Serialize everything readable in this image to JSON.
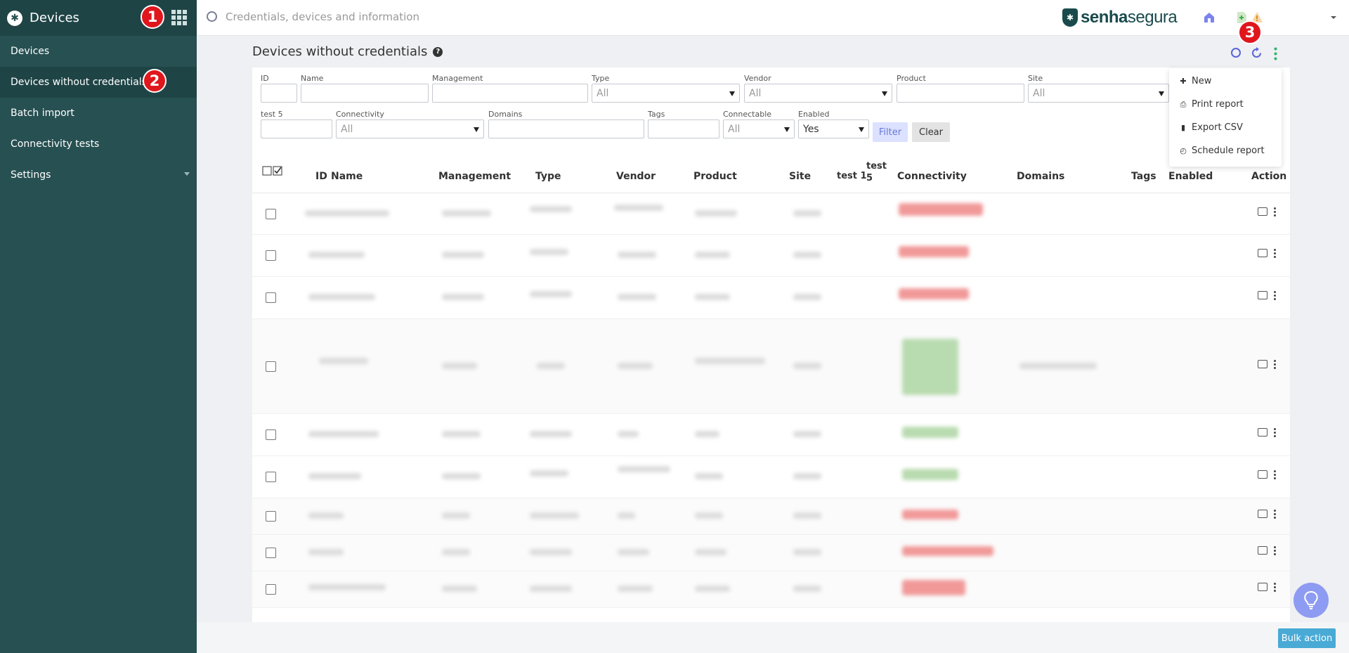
{
  "sidebar": {
    "title": "Devices",
    "items": [
      {
        "label": "Devices"
      },
      {
        "label": "Devices without credentials"
      },
      {
        "label": "Batch import"
      },
      {
        "label": "Connectivity tests"
      },
      {
        "label": "Settings"
      }
    ]
  },
  "markers": [
    "1",
    "2",
    "3"
  ],
  "topbar": {
    "search_placeholder": "Credentials, devices and information",
    "brand_bold": "senha",
    "brand_light": "segura"
  },
  "page": {
    "title": "Devices without credentials"
  },
  "filters": {
    "id": {
      "label": "ID",
      "value": ""
    },
    "name": {
      "label": "Name",
      "value": ""
    },
    "management": {
      "label": "Management",
      "value": ""
    },
    "type": {
      "label": "Type",
      "value": "All"
    },
    "vendor": {
      "label": "Vendor",
      "value": "All"
    },
    "product": {
      "label": "Product",
      "value": ""
    },
    "site": {
      "label": "Site",
      "value": "All"
    },
    "test5": {
      "label": "test 5",
      "value": ""
    },
    "connectivity": {
      "label": "Connectivity",
      "value": "All"
    },
    "domains": {
      "label": "Domains",
      "value": ""
    },
    "tags": {
      "label": "Tags",
      "value": ""
    },
    "connectable": {
      "label": "Connectable",
      "value": "All"
    },
    "enabled": {
      "label": "Enabled",
      "value": "Yes"
    },
    "filter_button": "Filter",
    "clear_button": "Clear"
  },
  "table": {
    "columns": [
      "ID",
      "Name",
      "Management",
      "Type",
      "Vendor",
      "Product",
      "Site",
      "test 1",
      "test 5",
      "Connectivity",
      "Domains",
      "Tags",
      "Enabled",
      "Action"
    ]
  },
  "dropdown": {
    "items": [
      {
        "icon": "plus-icon",
        "label": "New"
      },
      {
        "icon": "print-icon",
        "label": "Print report"
      },
      {
        "icon": "file-icon",
        "label": "Export CSV"
      },
      {
        "icon": "clock-icon",
        "label": "Schedule report"
      }
    ]
  },
  "bottom": {
    "bulk_action": "Bulk action"
  },
  "colors": {
    "sidebar_bg": "#275052",
    "sidebar_active": "#1f4446",
    "accent_blue": "#4aaad6",
    "marker_red": "#e0161d"
  }
}
